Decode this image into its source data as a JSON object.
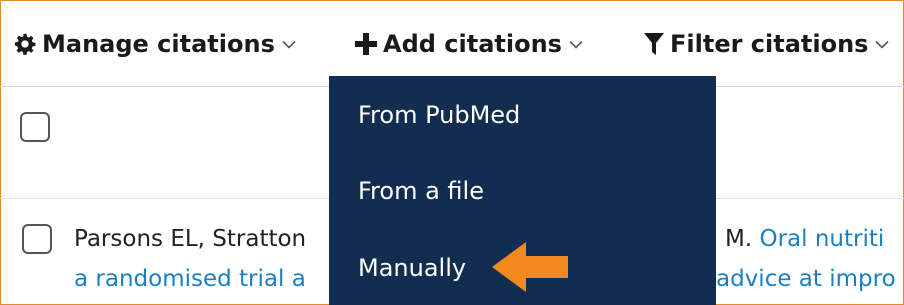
{
  "toolbar": {
    "manage_label": "Manage citations",
    "add_label": "Add citations",
    "filter_label": "Filter citations",
    "icons": {
      "manage": "gear-icon",
      "add": "plus-icon",
      "filter": "funnel-icon",
      "dropdown": "chevron-down-icon"
    }
  },
  "citation": {
    "authors_left": "Parsons EL, Stratton",
    "authors_right": "M.",
    "title_right": "Oral nutriti",
    "title_line2_left": "a randomised trial a",
    "title_line2_right": "advice at impro"
  },
  "add_menu": {
    "items": [
      "From PubMed",
      "From a file",
      "Manually"
    ]
  },
  "colors": {
    "menu_bg": "#132d50",
    "link": "#1b7fc4",
    "highlight_arrow": "#f28a1e",
    "frame_border": "#e08b2c"
  }
}
